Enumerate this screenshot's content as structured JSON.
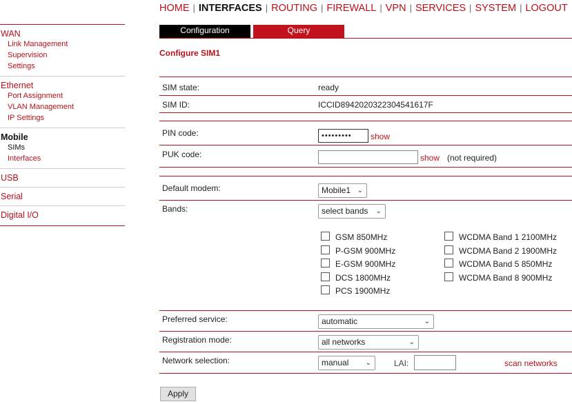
{
  "nav": {
    "items": [
      {
        "label": "HOME"
      },
      {
        "label": "INTERFACES"
      },
      {
        "label": "ROUTING"
      },
      {
        "label": "FIREWALL"
      },
      {
        "label": "VPN"
      },
      {
        "label": "SERVICES"
      },
      {
        "label": "SYSTEM"
      },
      {
        "label": "LOGOUT"
      }
    ],
    "separator": "|"
  },
  "sidebar": {
    "wan": {
      "title": "WAN",
      "items": [
        "Link Management",
        "Supervision",
        "Settings"
      ]
    },
    "ethernet": {
      "title": "Ethernet",
      "items": [
        "Port Assignment",
        "VLAN Management",
        "IP Settings"
      ]
    },
    "mobile": {
      "title": "Mobile",
      "items": [
        "SIMs",
        "Interfaces"
      ]
    },
    "usb": {
      "title": "USB"
    },
    "serial": {
      "title": "Serial"
    },
    "digital_io": {
      "title": "Digital I/O"
    }
  },
  "tabs": {
    "configuration": "Configuration",
    "query": "Query"
  },
  "page_title": "Configure SIM1",
  "form": {
    "sim_state": {
      "label": "SIM state:",
      "value": "ready"
    },
    "sim_id": {
      "label": "SIM ID:",
      "value": "ICCID8942020322304541617F"
    },
    "pin_code": {
      "label": "PIN code:",
      "value": "•••••••••",
      "show": "show"
    },
    "puk_code": {
      "label": "PUK code:",
      "value": "",
      "show": "show",
      "note": "(not required)"
    },
    "default_modem": {
      "label": "Default modem:",
      "value": "Mobile1"
    },
    "bands": {
      "label": "Bands:",
      "value": "select bands",
      "left": [
        "GSM 850MHz",
        "P-GSM 900MHz",
        "E-GSM 900MHz",
        "DCS 1800MHz",
        "PCS 1900MHz"
      ],
      "right": [
        "WCDMA Band 1 2100MHz",
        "WCDMA Band 2 1900MHz",
        "WCDMA Band 5 850MHz",
        "WCDMA Band 8 900MHz"
      ]
    },
    "preferred_service": {
      "label": "Preferred service:",
      "value": "automatic"
    },
    "registration_mode": {
      "label": "Registration mode:",
      "value": "all networks"
    },
    "network_selection": {
      "label": "Network selection:",
      "value": "manual",
      "lai_label": "LAI:",
      "lai_value": "",
      "scan": "scan networks"
    }
  },
  "apply_label": "Apply",
  "colors": {
    "accent": "#b5121b",
    "tab_active": "#000000",
    "tab_inactive": "#c2121d"
  }
}
